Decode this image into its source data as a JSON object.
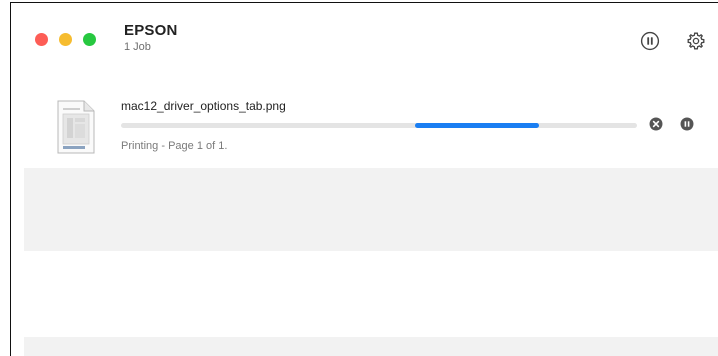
{
  "window": {
    "title": "EPSON",
    "subtitle": "1 Job",
    "traffic_lights": {
      "close": "#fd5d56",
      "minimize": "#f6bc2f",
      "zoom": "#27c840"
    }
  },
  "toolbar": {
    "pause_icon": "pause-circle-icon",
    "settings_icon": "gear-icon"
  },
  "job": {
    "filename": "mac12_driver_options_tab.png",
    "status": "Printing - Page 1 of 1.",
    "progress_indicator": {
      "start_fraction": 0.57,
      "end_fraction": 0.81,
      "color": "#1a7ef2"
    },
    "cancel_icon": "x-circle-icon",
    "hold_icon": "pause-circle-filled-icon"
  }
}
